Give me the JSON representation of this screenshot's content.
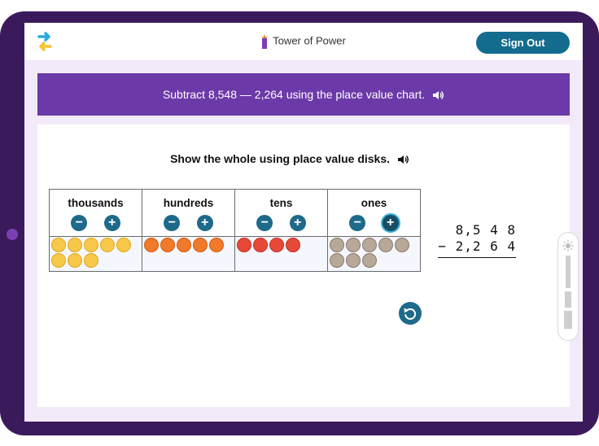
{
  "app": {
    "title": "Tower of Power",
    "sign_out": "Sign Out"
  },
  "banner": {
    "text": "Subtract 8,548 — 2,264 using the place value chart.",
    "icon": "speaker-icon"
  },
  "instruction": {
    "text": "Show the whole using place value disks.",
    "icon": "speaker-icon"
  },
  "chart": {
    "columns": [
      {
        "label": "thousands",
        "disks": 8,
        "color": "#f8c84a",
        "border": "#e0a820"
      },
      {
        "label": "hundreds",
        "disks": 5,
        "color": "#f07a2a",
        "border": "#d35a10"
      },
      {
        "label": "tens",
        "disks": 4,
        "color": "#e84a3a",
        "border": "#c8281c"
      },
      {
        "label": "ones",
        "disks": 8,
        "color": "#b8a898",
        "border": "#8a7a6a"
      }
    ],
    "minus_label": "−",
    "plus_label": "+"
  },
  "problem": {
    "top": "8,5 4 8",
    "bottom": "− 2,2 6 4"
  },
  "colors": {
    "frame": "#3b1a5c",
    "banner": "#6c3aa8",
    "accent": "#136c8e",
    "button": "#1e6a8a"
  }
}
